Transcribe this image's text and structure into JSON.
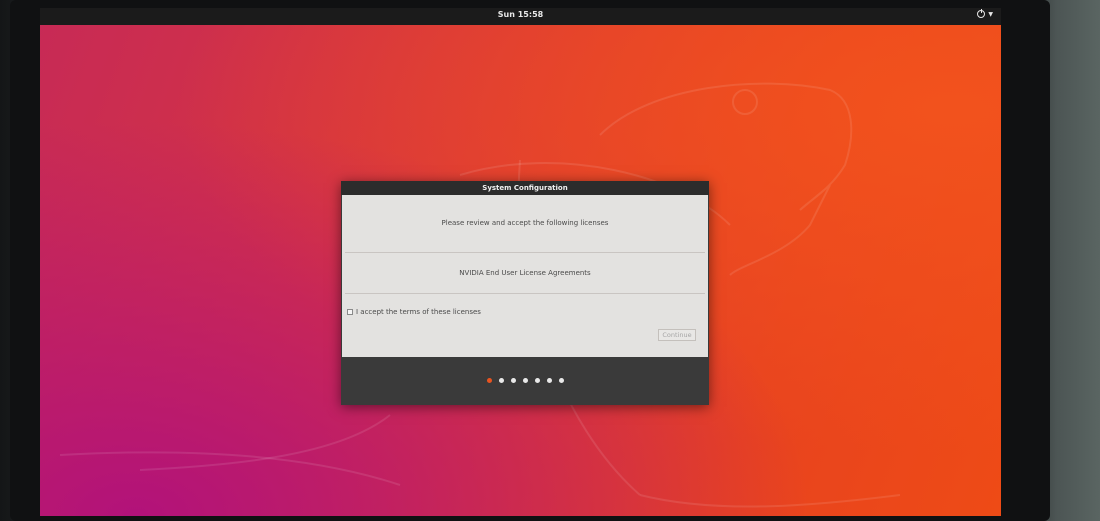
{
  "top_bar": {
    "clock": "Sun 15:58",
    "power_icon": "power-icon",
    "menu_icon": "chevron-down-icon"
  },
  "dialog": {
    "title": "System Configuration",
    "review_text": "Please review and accept the following licenses",
    "license_item": "NVIDIA End User License Agreements",
    "accept_label": "I accept the terms of these licenses",
    "accept_checked": false,
    "continue_label": "Continue",
    "continue_enabled": false
  },
  "progress": {
    "total_steps": 7,
    "current_step": 1
  },
  "colors": {
    "ubuntu_orange": "#e95420",
    "top_bar": "#1b1b1b",
    "dialog_frame": "#3a3a3a",
    "dialog_body": "#e3e2e0"
  }
}
